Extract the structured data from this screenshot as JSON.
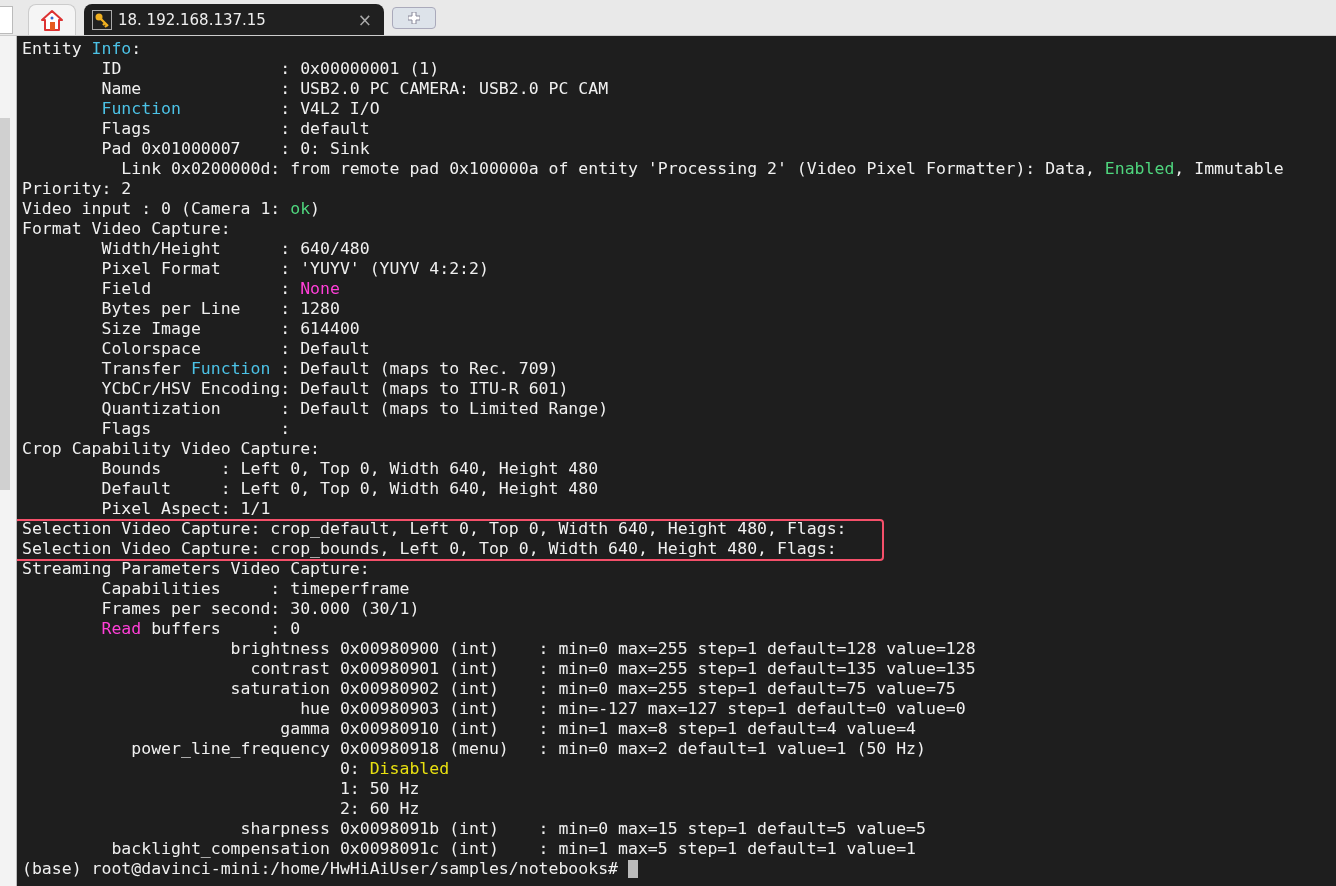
{
  "tabs": [
    {
      "kind": "home",
      "selected": false
    },
    {
      "kind": "session",
      "title": "18. 192.168.137.15",
      "close": "×",
      "selected": true
    },
    {
      "kind": "new",
      "selected": false
    }
  ],
  "terminal": {
    "lines": [
      {
        "segments": [
          {
            "text": "Entity "
          },
          {
            "text": "Info",
            "color": "#4cc2e6"
          },
          {
            "text": ":"
          }
        ]
      },
      {
        "segments": [
          {
            "text": "        ID                : 0x00000001 (1)"
          }
        ]
      },
      {
        "segments": [
          {
            "text": "        Name              : USB2.0 PC CAMERA: USB2.0 PC CAM"
          }
        ]
      },
      {
        "segments": [
          {
            "text": "        Function",
            "color": "#4cc2e6"
          },
          {
            "text": "          : V4L2 I/O"
          }
        ]
      },
      {
        "segments": [
          {
            "text": "        Flags             : default"
          }
        ]
      },
      {
        "segments": [
          {
            "text": "        Pad 0x01000007    : 0: Sink"
          }
        ]
      },
      {
        "segments": [
          {
            "text": "          Link 0x0200000d: from remote pad 0x100000a of entity 'Processing 2' (Video Pixel Formatter): Data, "
          },
          {
            "text": "Enabled",
            "color": "#4fd67e"
          },
          {
            "text": ", Immutable"
          }
        ]
      },
      {
        "segments": [
          {
            "text": "Priority: 2"
          }
        ]
      },
      {
        "segments": [
          {
            "text": "Video input : 0 (Camera 1: "
          },
          {
            "text": "ok",
            "color": "#4fd67e"
          },
          {
            "text": ")"
          }
        ]
      },
      {
        "segments": [
          {
            "text": "Format Video Capture:"
          }
        ]
      },
      {
        "segments": [
          {
            "text": "        Width/Height      : 640/480"
          }
        ]
      },
      {
        "segments": [
          {
            "text": "        Pixel Format      : 'YUYV' (YUYV 4:2:2)"
          }
        ]
      },
      {
        "segments": [
          {
            "text": "        Field             : "
          },
          {
            "text": "None",
            "color": "#ff3fd8"
          }
        ]
      },
      {
        "segments": [
          {
            "text": "        Bytes per Line    : 1280"
          }
        ]
      },
      {
        "segments": [
          {
            "text": "        Size Image        : 614400"
          }
        ]
      },
      {
        "segments": [
          {
            "text": "        Colorspace        : Default"
          }
        ]
      },
      {
        "segments": [
          {
            "text": "        Transfer "
          },
          {
            "text": "Function",
            "color": "#4cc2e6"
          },
          {
            "text": " : Default (maps to Rec. 709)"
          }
        ]
      },
      {
        "segments": [
          {
            "text": "        YCbCr/HSV Encoding: Default (maps to ITU-R 601)"
          }
        ]
      },
      {
        "segments": [
          {
            "text": "        Quantization      : Default (maps to Limited Range)"
          }
        ]
      },
      {
        "segments": [
          {
            "text": "        Flags             :"
          }
        ]
      },
      {
        "segments": [
          {
            "text": "Crop Capability Video Capture:"
          }
        ]
      },
      {
        "segments": [
          {
            "text": "        Bounds      : Left 0, Top 0, Width 640, Height 480"
          }
        ]
      },
      {
        "segments": [
          {
            "text": "        Default     : Left 0, Top 0, Width 640, Height 480"
          }
        ]
      },
      {
        "segments": [
          {
            "text": "        Pixel Aspect: 1/1"
          }
        ]
      },
      {
        "segments": [
          {
            "text": "Selection Video Capture: crop_default, Left 0, Top 0, Width 640, Height 480, Flags:"
          }
        ]
      },
      {
        "segments": [
          {
            "text": "Selection Video Capture: crop_bounds, Left 0, Top 0, Width 640, Height 480, Flags:"
          }
        ]
      },
      {
        "segments": [
          {
            "text": "Streaming Parameters Video Capture:"
          }
        ]
      },
      {
        "segments": [
          {
            "text": "        Capabilities     : timeperframe"
          }
        ]
      },
      {
        "segments": [
          {
            "text": "        Frames per second: 30.000 (30/1)"
          }
        ]
      },
      {
        "segments": [
          {
            "text": "        Read",
            "color": "#ff3fd8"
          },
          {
            "text": " buffers     : 0"
          }
        ]
      },
      {
        "segments": [
          {
            "text": "                     brightness 0x00980900 (int)    : min=0 max=255 step=1 default=128 value=128"
          }
        ]
      },
      {
        "segments": [
          {
            "text": "                       contrast 0x00980901 (int)    : min=0 max=255 step=1 default=135 value=135"
          }
        ]
      },
      {
        "segments": [
          {
            "text": "                     saturation 0x00980902 (int)    : min=0 max=255 step=1 default=75 value=75"
          }
        ]
      },
      {
        "segments": [
          {
            "text": "                            hue 0x00980903 (int)    : min=-127 max=127 step=1 default=0 value=0"
          }
        ]
      },
      {
        "segments": [
          {
            "text": "                          gamma 0x00980910 (int)    : min=1 max=8 step=1 default=4 value=4"
          }
        ]
      },
      {
        "segments": [
          {
            "text": "           power_line_frequency 0x00980918 (menu)   : min=0 max=2 default=1 value=1 (50 Hz)"
          }
        ]
      },
      {
        "segments": [
          {
            "text": "                                0: "
          },
          {
            "text": "Disabled",
            "color": "#e8e010"
          }
        ]
      },
      {
        "segments": [
          {
            "text": "                                1: 50 Hz"
          }
        ]
      },
      {
        "segments": [
          {
            "text": "                                2: 60 Hz"
          }
        ]
      },
      {
        "segments": [
          {
            "text": "                      sharpness 0x0098091b (int)    : min=0 max=15 step=1 default=5 value=5"
          }
        ]
      },
      {
        "segments": [
          {
            "text": "         backlight_compensation 0x0098091c (int)    : min=1 max=5 step=1 default=1 value=1"
          }
        ]
      }
    ],
    "prompt": "(base) root@davinci-mini:/home/HwHiAiUser/samples/notebooks# "
  }
}
